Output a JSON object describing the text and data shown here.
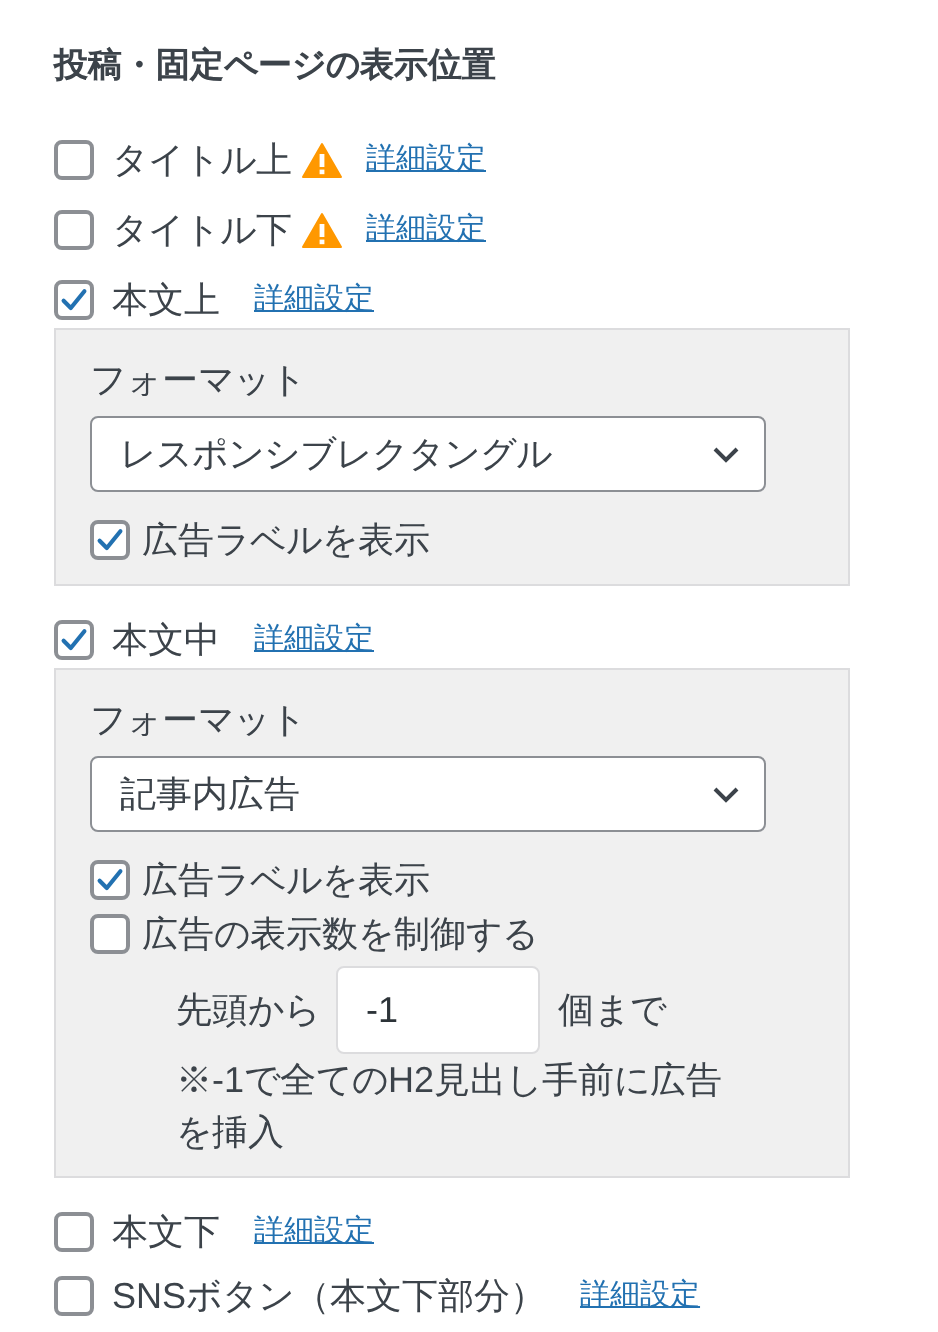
{
  "heading": "投稿・固定ページの表示位置",
  "positions": [
    {
      "label": "タイトル上",
      "checked": false,
      "warning": true,
      "link": "詳細設定"
    },
    {
      "label": "タイトル下",
      "checked": false,
      "warning": true,
      "link": "詳細設定"
    },
    {
      "label": "本文上",
      "checked": true,
      "warning": false,
      "link": "詳細設定",
      "settings": {
        "format_label": "フォーマット",
        "format": "レスポンシブレクタングル",
        "options": [
          {
            "label": "広告ラベルを表示",
            "checked": true
          }
        ]
      }
    },
    {
      "label": "本文中",
      "checked": true,
      "warning": false,
      "link": "詳細設定",
      "settings": {
        "format_label": "フォーマット",
        "format": "記事内広告",
        "options": [
          {
            "label": "広告ラベルを表示",
            "checked": true
          },
          {
            "label": "広告の表示数を制御する",
            "checked": false
          }
        ],
        "count": {
          "prefix": "先頭から",
          "value": "-1",
          "suffix": "個まで",
          "note": "※-1で全てのH2見出し手前に広告を挿入"
        }
      }
    },
    {
      "label": "本文下",
      "checked": false,
      "warning": false,
      "link": "詳細設定"
    },
    {
      "label": "SNSボタン（本文下部分）",
      "checked": false,
      "warning": false,
      "link": "詳細設定"
    }
  ]
}
